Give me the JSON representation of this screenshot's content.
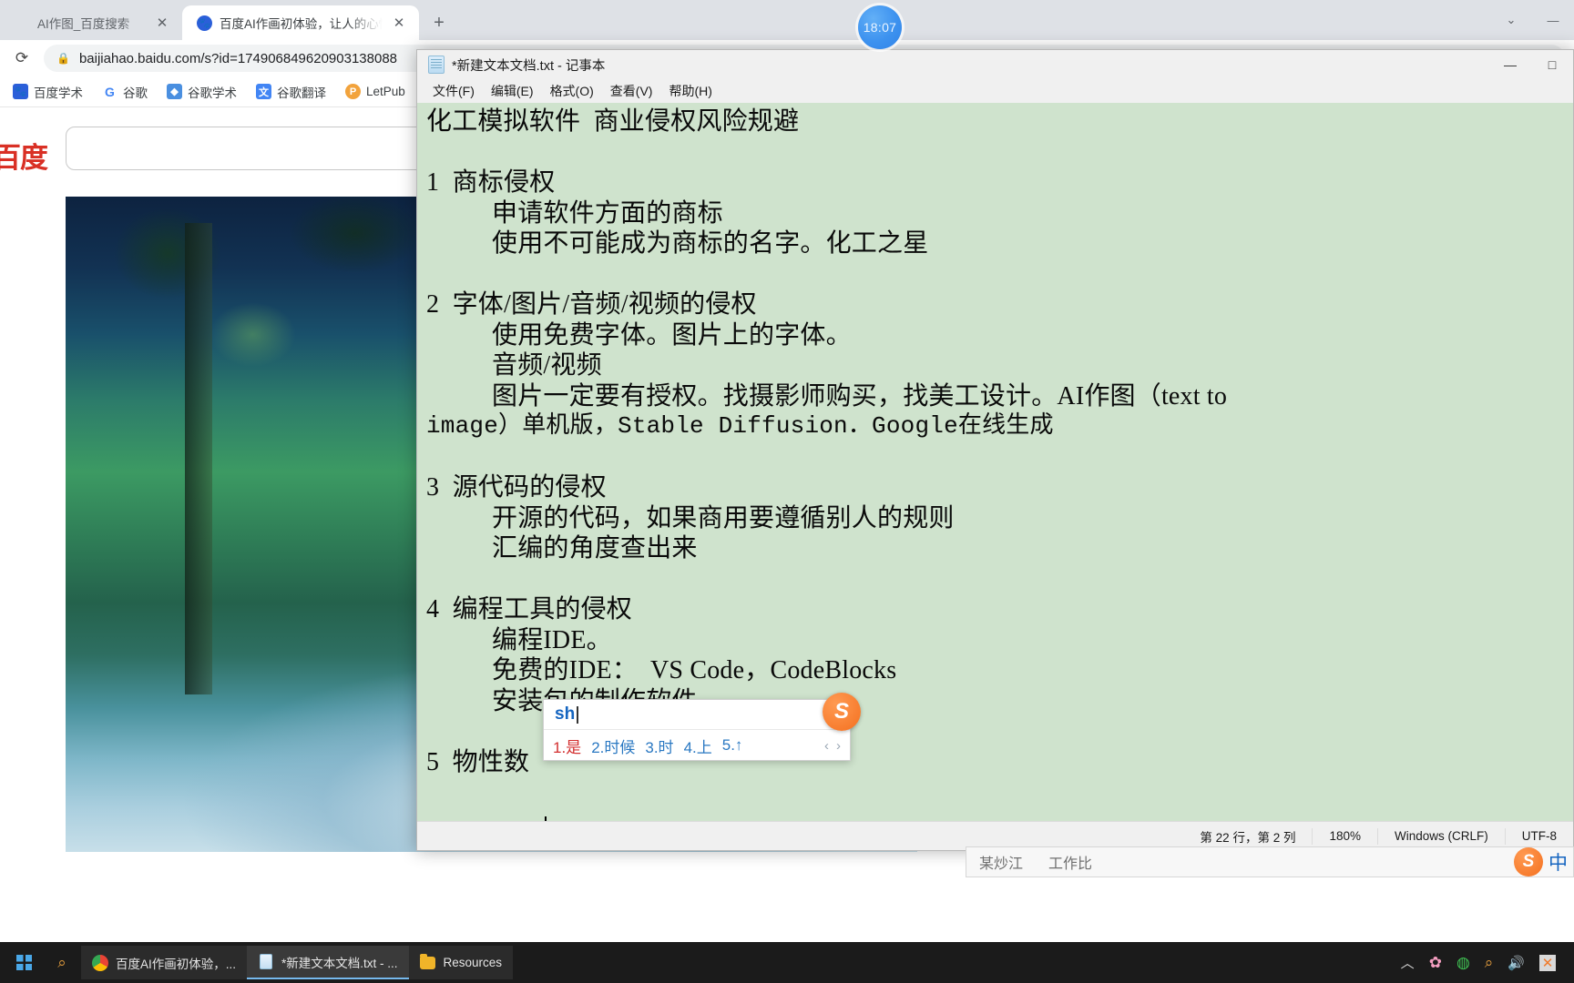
{
  "browser": {
    "tabs": [
      {
        "title": "AI作图_百度搜索",
        "favicon": "",
        "active": false
      },
      {
        "title": "百度AI作画初体验，让人的心情",
        "favicon": "baidu-paw-icon",
        "active": true
      }
    ],
    "new_tab_label": "+",
    "window_controls": {
      "chevron": "⌄",
      "minimize": "—"
    },
    "clock": "18:07",
    "toolbar": {
      "reload_icon": "⟳",
      "lock_icon": "🔒",
      "url": "baijiahao.baidu.com/s?id=174906849620903138088"
    },
    "bookmarks": [
      {
        "label": "百度学术",
        "icon": "baidu-paw-icon",
        "color": "#2b5fd9"
      },
      {
        "label": "谷歌",
        "icon": "google-g-icon",
        "color": "#ffffff"
      },
      {
        "label": "谷歌学术",
        "icon": "scholar-icon",
        "color": "#4a8fe0"
      },
      {
        "label": "谷歌翻译",
        "icon": "translate-icon",
        "color": "#4285f4"
      },
      {
        "label": "LetPub",
        "icon": "letpub-icon",
        "color": "#f2a33c"
      }
    ]
  },
  "page": {
    "logo_text": "百度",
    "search_placeholder": "",
    "search_value": ""
  },
  "notepad": {
    "title": "*新建文本文档.txt - 记事本",
    "icon": "notepad-icon",
    "window_controls": {
      "minimize": "—",
      "maximize": "□"
    },
    "menu": [
      "文件(F)",
      "编辑(E)",
      "格式(O)",
      "查看(V)",
      "帮助(H)"
    ],
    "lines": [
      {
        "text": "化工模拟软件  商业侵权风险规避",
        "mono": false
      },
      {
        "text": "",
        "mono": false
      },
      {
        "text": "1  商标侵权",
        "mono": false
      },
      {
        "text": "          申请软件方面的商标",
        "mono": false
      },
      {
        "text": "          使用不可能成为商标的名字。化工之星",
        "mono": false
      },
      {
        "text": "",
        "mono": false
      },
      {
        "text": "2  字体/图片/音频/视频的侵权",
        "mono": false
      },
      {
        "text": "          使用免费字体。图片上的字体。",
        "mono": false
      },
      {
        "text": "          音频/视频",
        "mono": false
      },
      {
        "text": "          图片一定要有授权。找摄影师购买，找美工设计。AI作图（text to",
        "mono": false
      },
      {
        "text": "image）单机版，Stable Diffusion．Google在线生成",
        "mono": true
      },
      {
        "text": "",
        "mono": false
      },
      {
        "text": "3  源代码的侵权",
        "mono": false
      },
      {
        "text": "          开源的代码，如果商用要遵循别人的规则",
        "mono": false
      },
      {
        "text": "          汇编的角度查出来",
        "mono": false
      },
      {
        "text": "",
        "mono": false
      },
      {
        "text": "4  编程工具的侵权",
        "mono": false
      },
      {
        "text": "          编程IDE。",
        "mono": false
      },
      {
        "text": "          免费的IDE：  VS Code，CodeBlocks",
        "mono": false
      },
      {
        "text": "          安装包的制作软件",
        "mono": false
      },
      {
        "text": "",
        "mono": false
      },
      {
        "text": "5  物性数",
        "mono": false
      }
    ],
    "status": {
      "position": "第 22 行，第 2 列",
      "zoom": "180%",
      "line_ending": "Windows (CRLF)",
      "encoding": "UTF-8"
    }
  },
  "ime": {
    "composition": "sh",
    "candidates": [
      "1.是",
      "2.时候",
      "3.时",
      "4.上",
      "5.↑"
    ],
    "prev_arrow": "‹",
    "next_arrow": "›",
    "logo": "S"
  },
  "ime_bar": {
    "text1": "某炒江",
    "text2": "工作比",
    "logo": "S",
    "mode": "中"
  },
  "taskbar": {
    "start_label": "",
    "search_label": "",
    "items": [
      {
        "label": "百度AI作画初体验，...",
        "icon": "chrome-icon",
        "active": false
      },
      {
        "label": "*新建文本文档.txt - ...",
        "icon": "notepad-icon",
        "active": true
      },
      {
        "label": "Resources",
        "icon": "folder-icon",
        "active": false
      }
    ],
    "tray": [
      {
        "name": "show-hidden-icons",
        "glyph": "︿"
      },
      {
        "name": "flower-icon",
        "glyph": "✿"
      },
      {
        "name": "wechat-icon",
        "glyph": "◍"
      },
      {
        "name": "search-tray-icon",
        "glyph": "⌕"
      },
      {
        "name": "volume-icon",
        "glyph": "🔊"
      },
      {
        "name": "xmind-icon",
        "glyph": "✕"
      }
    ]
  }
}
